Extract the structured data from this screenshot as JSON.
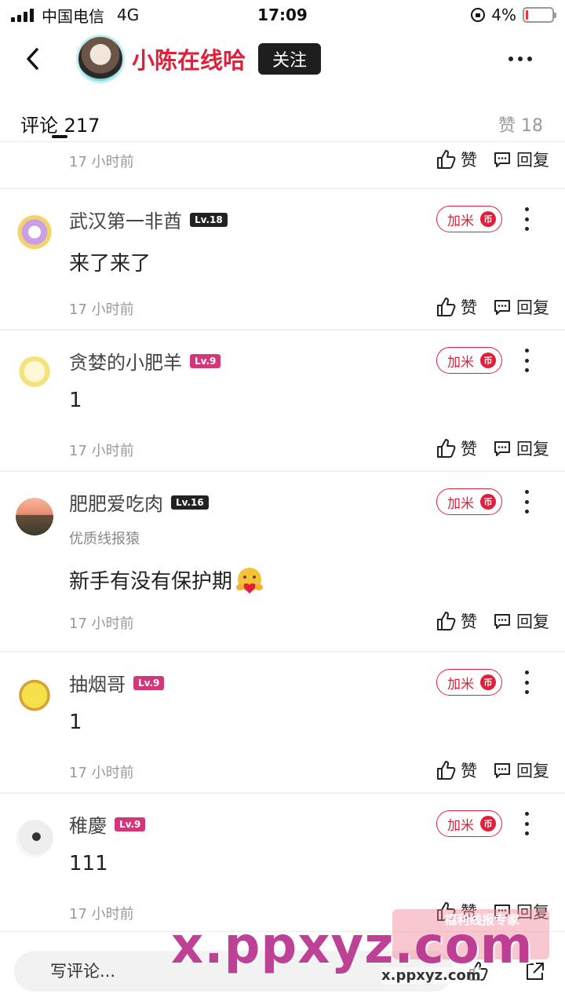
{
  "status_bar": {
    "carrier": "中国电信",
    "network": "4G",
    "time": "17:09",
    "battery": "4%"
  },
  "header": {
    "author_name": "小陈在线哈",
    "follow_label": "关注"
  },
  "tabs": {
    "comments_label": "评论",
    "comments_count": "217",
    "likes_label": "赞",
    "likes_count": "18"
  },
  "actions": {
    "like_label": "赞",
    "reply_label": "回复",
    "jiami_label": "加米",
    "coin_glyph": "币"
  },
  "partial_comment": {
    "time": "17 小时前"
  },
  "comments": [
    {
      "username": "武汉第一非酋",
      "level": "Lv.18",
      "level_style": "dark",
      "subtitle": "",
      "content": "来了来了",
      "time": "17 小时前",
      "avatar": "anime-avatar"
    },
    {
      "username": "贪婪的小肥羊",
      "level": "Lv.9",
      "level_style": "pink",
      "subtitle": "",
      "content": "1",
      "time": "17 小时前",
      "avatar": "sheep-avatar"
    },
    {
      "username": "肥肥爱吃肉",
      "level": "Lv.16",
      "level_style": "dark",
      "subtitle": "优质线报猿",
      "content": "新手有没有保护期",
      "emoji": "hug-emoji",
      "time": "17 小时前",
      "avatar": "sunset-avatar"
    },
    {
      "username": "抽烟哥",
      "level": "Lv.9",
      "level_style": "pink",
      "subtitle": "",
      "content": "1",
      "time": "17 小时前",
      "avatar": "sponge-avatar"
    },
    {
      "username": "稚慶",
      "level": "Lv.9",
      "level_style": "pink",
      "subtitle": "",
      "content": "111",
      "time": "17 小时前",
      "avatar": "sketch-avatar"
    }
  ],
  "bottom_bar": {
    "input_placeholder": "写评论..."
  },
  "watermark": {
    "main": "x.ppxyz.com",
    "sub": "x.ppxyz.com",
    "badge": "福利线报专家"
  },
  "colors": {
    "accent_red": "#e0203a",
    "level_dark": "#222222",
    "level_pink": "#d2377a"
  }
}
